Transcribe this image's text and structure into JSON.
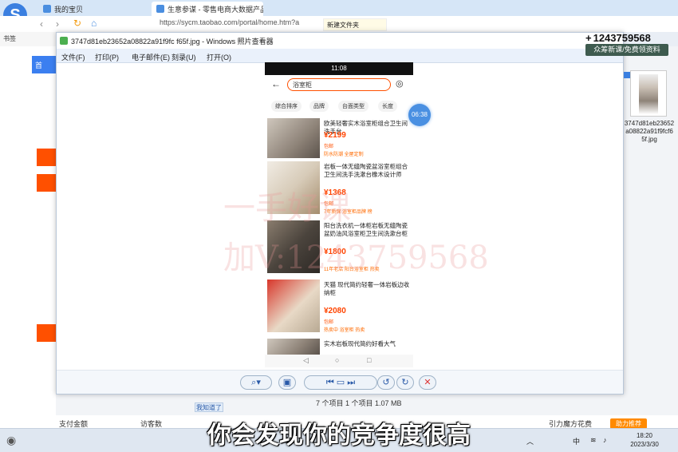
{
  "browser": {
    "tabs": [
      "我的宝贝",
      "生意参谋 - 零售电商大数据产品"
    ],
    "url": "https://sycm.taobao.com/portal/home.htm?a",
    "new_tab": "新建文件夹",
    "favorites": "书签"
  },
  "viewer": {
    "title": "3747d81eb23652a08822a91f9fc f65f.jpg - Windows 照片查看器",
    "menu": [
      "文件(F)",
      "打印(P)",
      "电子邮件(E)",
      "刻录(U)",
      "打开(O)"
    ],
    "status": "7 个项目  1 个项目  1.07 MB"
  },
  "phone": {
    "status_time": "11:08",
    "search_query": "浴室柜",
    "filters": [
      "综合排序",
      "品牌",
      "台面类型",
      "长度"
    ],
    "products": [
      {
        "title": "欧美轻奢实木浴室柜组合卫生间洗手台",
        "price": "¥2199",
        "tag": "包邮",
        "note": "防水防潮 全屋定制"
      },
      {
        "title": "岩板一体无缝陶瓷盆浴室柜组合卫生间洗手洗漱台橡木设计师",
        "price": "¥1368",
        "tag": "包邮",
        "note": "7年质保 浴室柜品牌 榜"
      },
      {
        "title": "阳台洗衣机一体柜岩板无缝陶瓷盆奶油风浴室柜卫生间洗漱台柜",
        "price": "¥1800",
        "tag": "",
        "note": "11年老店 阳台浴室柜 热卖"
      },
      {
        "title": "天猫 现代简约轻奢一体岩板边收纳柜",
        "price": "¥2080",
        "tag": "包邮",
        "note": "热卖中 浴室柜 热卖"
      },
      {
        "title": "实木岩板现代简约好看大气",
        "price": "",
        "tag": "",
        "note": ""
      }
    ],
    "timer": "06:38"
  },
  "overlay": {
    "phone_number": "1243759568",
    "promo": "众筹新课/免费领资料",
    "thumb_label": "3747d81eb23652a08822a91f9fcf65f.jpg",
    "subtitle": "你会发现你的竞争度很高",
    "watermark_1": "一手好课",
    "watermark_2": "加V:1243759568"
  },
  "bottom": {
    "col1": "支付金额",
    "col2": "访客数",
    "col3": "引力魔方花费",
    "help": "助力推荐",
    "btn": "我知道了"
  },
  "taskbar": {
    "time": "18:20",
    "date": "2023/3/30",
    "lang": "中"
  }
}
